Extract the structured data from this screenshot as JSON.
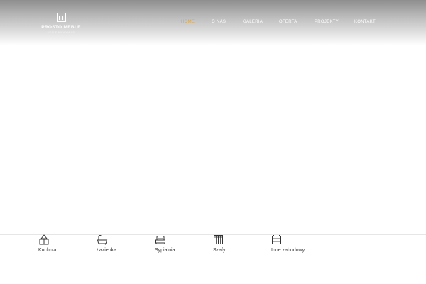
{
  "header": {
    "logo": {
      "name": "PROSTO MEBLE",
      "tagline": "MEBLE NA WYMIAR"
    },
    "nav": [
      {
        "label": "HOME",
        "active": true
      },
      {
        "label": "O NAS",
        "active": false
      },
      {
        "label": "GALERIA",
        "active": false
      },
      {
        "label": "OFERTA",
        "active": false
      },
      {
        "label": "PROJEKTY",
        "active": false
      },
      {
        "label": "KONTAKT",
        "active": false
      }
    ],
    "active_color": "#d3a95b"
  },
  "categories": [
    {
      "label": "Kuchnia",
      "icon": "kitchen-icon"
    },
    {
      "label": "Łazienka",
      "icon": "bathtub-icon"
    },
    {
      "label": "Sypialnia",
      "icon": "bed-icon"
    },
    {
      "label": "Szafy",
      "icon": "wardrobe-icon"
    },
    {
      "label": "Inne zabudowy",
      "icon": "shelving-icon"
    }
  ]
}
